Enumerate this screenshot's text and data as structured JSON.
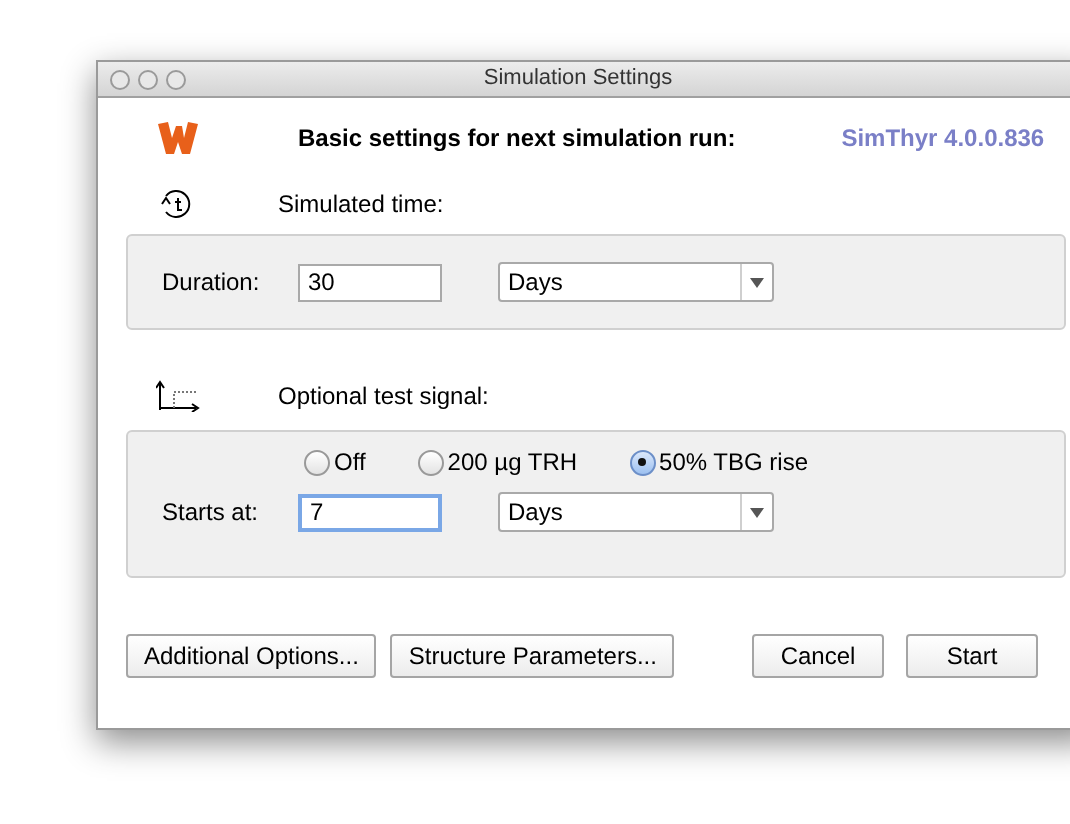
{
  "window": {
    "title": "Simulation Settings"
  },
  "header": {
    "heading": "Basic settings for next simulation run:",
    "version": "SimThyr 4.0.0.836"
  },
  "simulated_time": {
    "label": "Simulated time:",
    "duration_label": "Duration:",
    "duration_value": "30",
    "unit": "Days"
  },
  "test_signal": {
    "label": "Optional test signal:",
    "options": [
      {
        "label": "Off",
        "selected": false
      },
      {
        "label": "200 µg TRH",
        "selected": false
      },
      {
        "label": "50% TBG rise",
        "selected": true
      }
    ],
    "starts_label": "Starts at:",
    "starts_value": "7",
    "unit": "Days"
  },
  "buttons": [
    {
      "label": "Additional Options...",
      "kind": "left"
    },
    {
      "label": "Structure Parameters...",
      "kind": "left"
    },
    {
      "label": "Cancel",
      "kind": "right"
    },
    {
      "label": "Start",
      "kind": "right"
    }
  ]
}
